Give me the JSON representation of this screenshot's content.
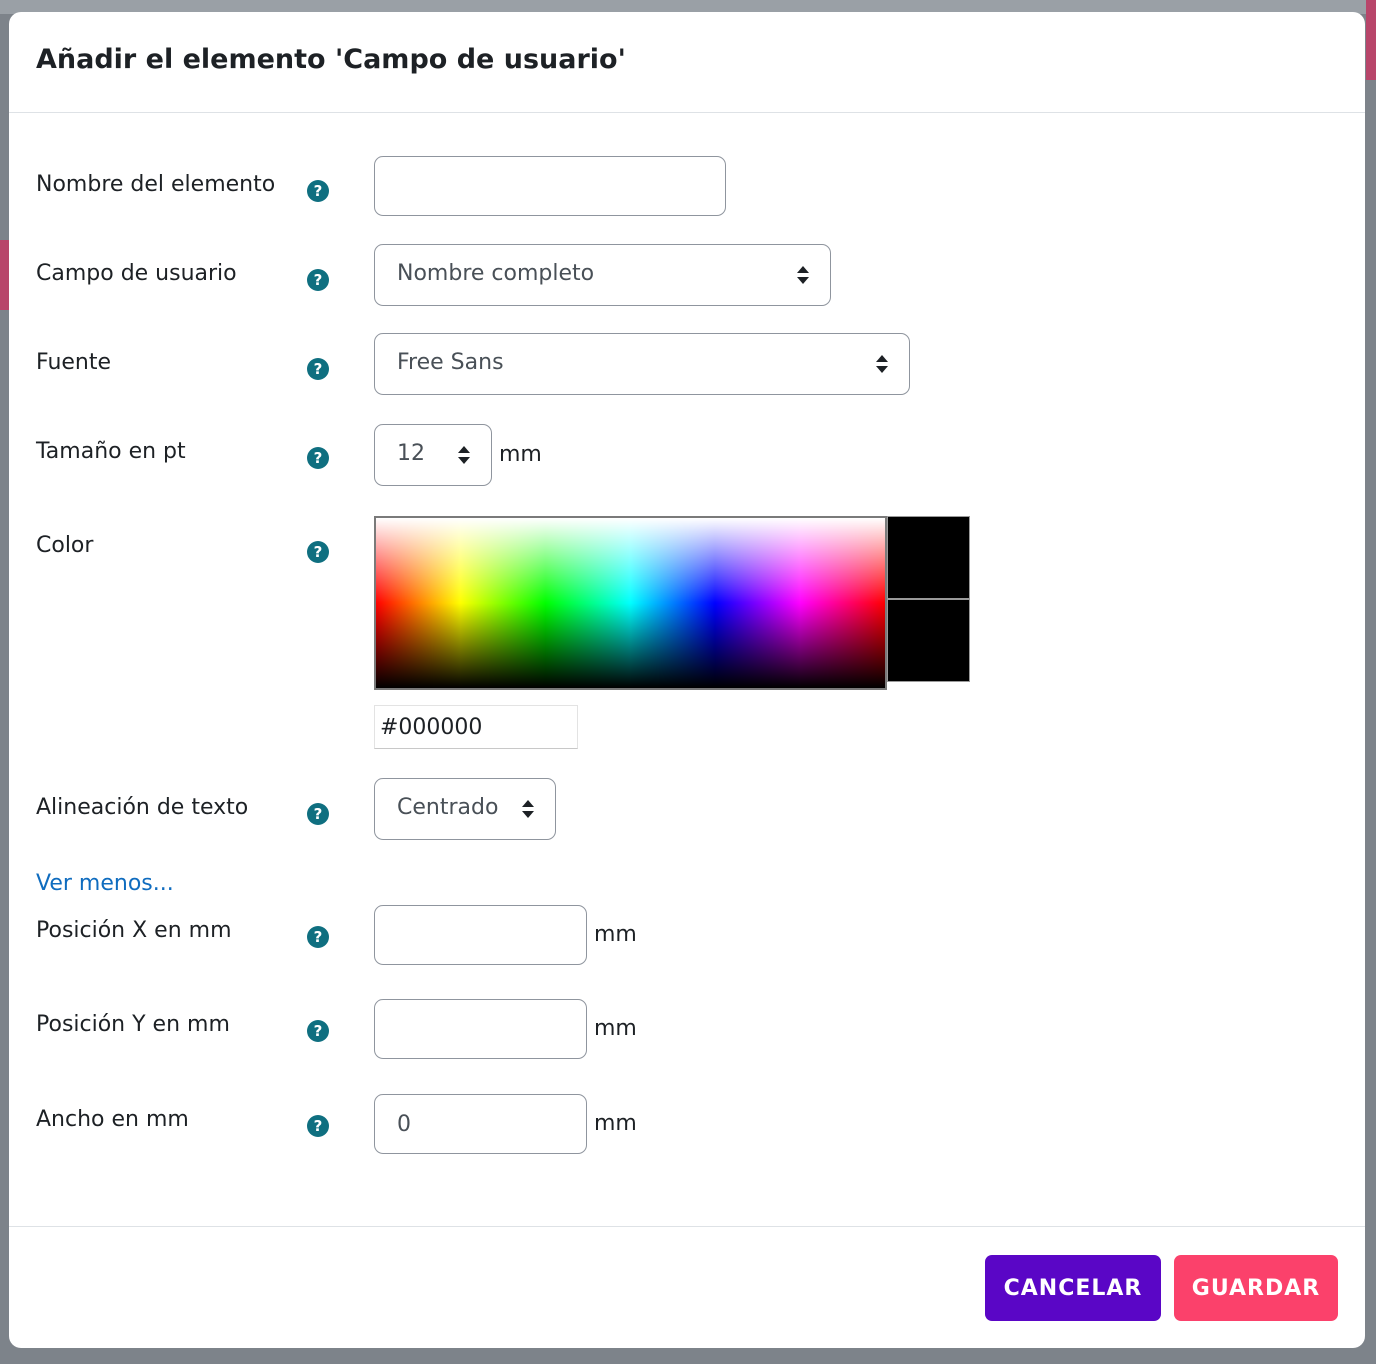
{
  "modal": {
    "title": "Añadir el elemento 'Campo de usuario'"
  },
  "form": {
    "element_name": {
      "label": "Nombre del elemento",
      "value": ""
    },
    "user_field": {
      "label": "Campo de usuario",
      "selected": "Nombre completo"
    },
    "font": {
      "label": "Fuente",
      "selected": "Free Sans"
    },
    "font_size": {
      "label": "Tamaño en pt",
      "selected": "12",
      "unit": "mm"
    },
    "color": {
      "label": "Color",
      "hex_value": "#000000",
      "swatch_color": "#000000"
    },
    "text_alignment": {
      "label": "Alineación de texto",
      "selected": "Centrado"
    },
    "show_less_link": "Ver menos...",
    "position_x": {
      "label": "Posición X en mm",
      "value": "",
      "unit": "mm"
    },
    "position_y": {
      "label": "Posición Y en mm",
      "value": "",
      "unit": "mm"
    },
    "width": {
      "label": "Ancho en mm",
      "value": "0",
      "unit": "mm"
    }
  },
  "help_icon": {
    "icon": "question-circle-icon",
    "glyph": "?",
    "color": "#0f6f80"
  },
  "footer": {
    "cancel_label": "CANCELAR",
    "save_label": "GUARDAR",
    "cancel_color": "#5a06c6",
    "save_color": "#fb416b"
  },
  "colors": {
    "link": "#0f6cbf",
    "input_border": "#8f959e"
  }
}
